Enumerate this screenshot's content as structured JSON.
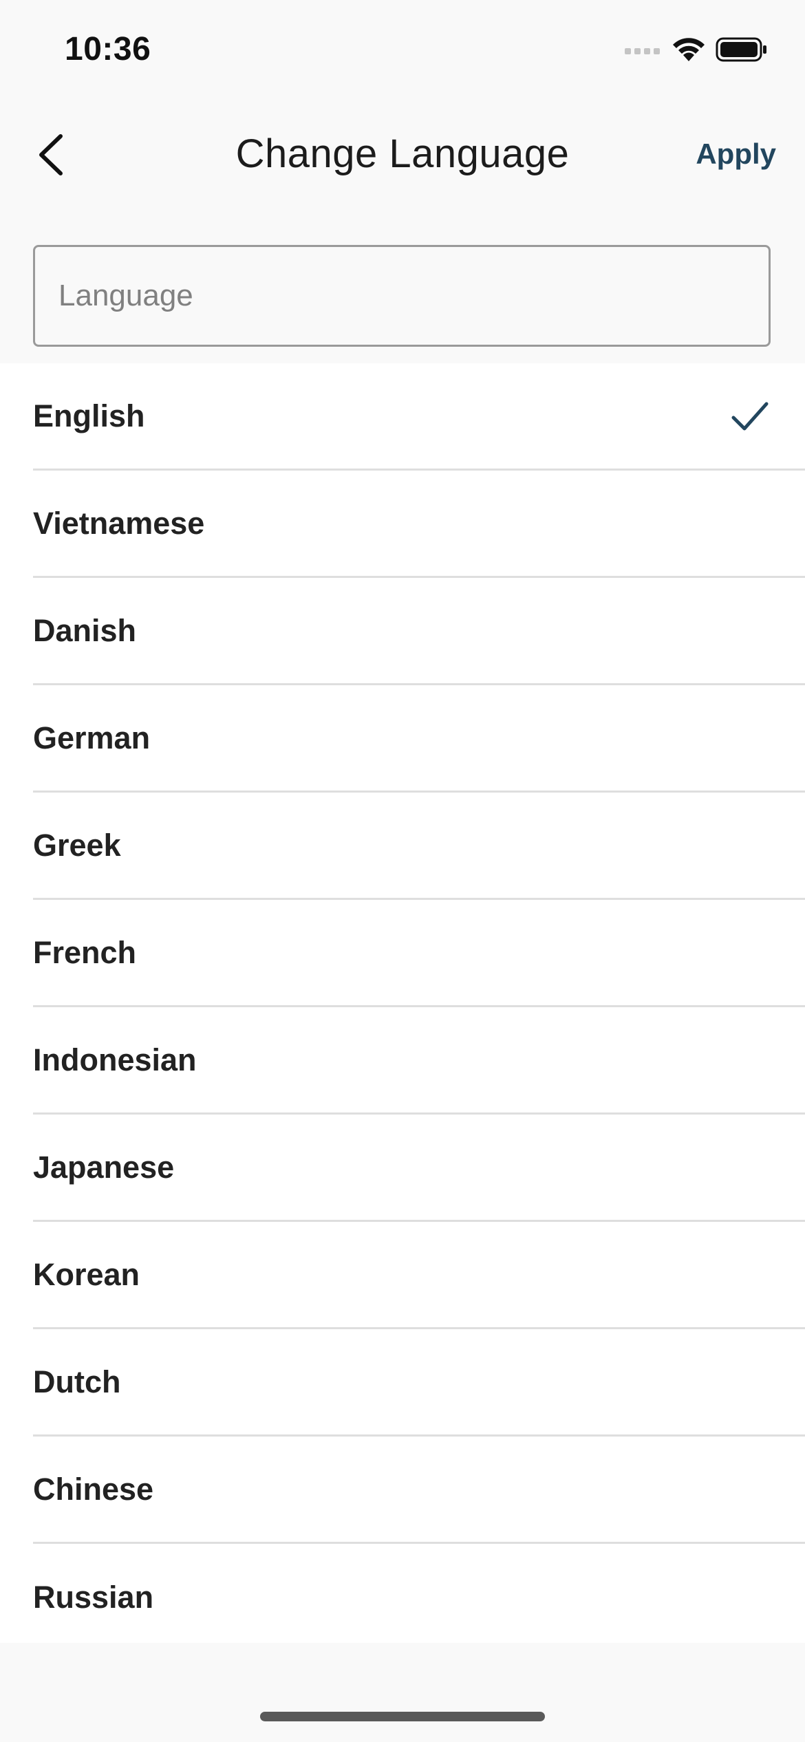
{
  "status_bar": {
    "time": "10:36"
  },
  "nav": {
    "title": "Change Language",
    "apply_label": "Apply",
    "back_icon": "chevron-left-icon"
  },
  "search": {
    "placeholder": "Language",
    "value": ""
  },
  "languages": [
    {
      "label": "English",
      "selected": true
    },
    {
      "label": "Vietnamese",
      "selected": false
    },
    {
      "label": "Danish",
      "selected": false
    },
    {
      "label": "German",
      "selected": false
    },
    {
      "label": "Greek",
      "selected": false
    },
    {
      "label": "French",
      "selected": false
    },
    {
      "label": "Indonesian",
      "selected": false
    },
    {
      "label": "Japanese",
      "selected": false
    },
    {
      "label": "Korean",
      "selected": false
    },
    {
      "label": "Dutch",
      "selected": false
    },
    {
      "label": "Chinese",
      "selected": false
    },
    {
      "label": "Russian",
      "selected": false
    }
  ],
  "colors": {
    "accent": "#22465e",
    "text": "#222222",
    "divider": "#dedede",
    "background": "#f9f9f9"
  }
}
